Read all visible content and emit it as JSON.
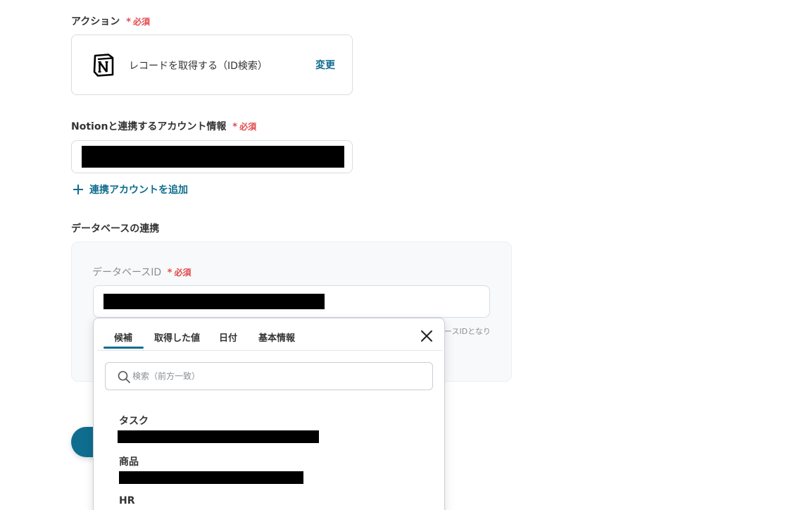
{
  "action": {
    "label": "アクション",
    "required": "必須",
    "required_mark": "*",
    "text": "レコードを取得する（ID検索）",
    "change": "変更",
    "logo": "notion-logo"
  },
  "account": {
    "label": "Notionと連携するアカウント情報",
    "required": "必須",
    "required_mark": "*",
    "add": "連携アカウントを追加"
  },
  "database": {
    "section_title": "データベースの連携",
    "id_label": "データベースID",
    "required": "必須",
    "required_mark": "*",
    "hint_fragment": "ースIDとなり"
  },
  "dropdown": {
    "tabs": [
      "候補",
      "取得した値",
      "日付",
      "基本情報"
    ],
    "active_tab": "候補",
    "search_placeholder": "検索（前方一致）",
    "options": [
      {
        "title": "タスク"
      },
      {
        "title": "商品"
      },
      {
        "title": "HR"
      }
    ]
  },
  "colors": {
    "accent": "#0f6d8f",
    "required": "#e5484d",
    "border": "#d6dde3",
    "panel": "#f8f9fa"
  }
}
